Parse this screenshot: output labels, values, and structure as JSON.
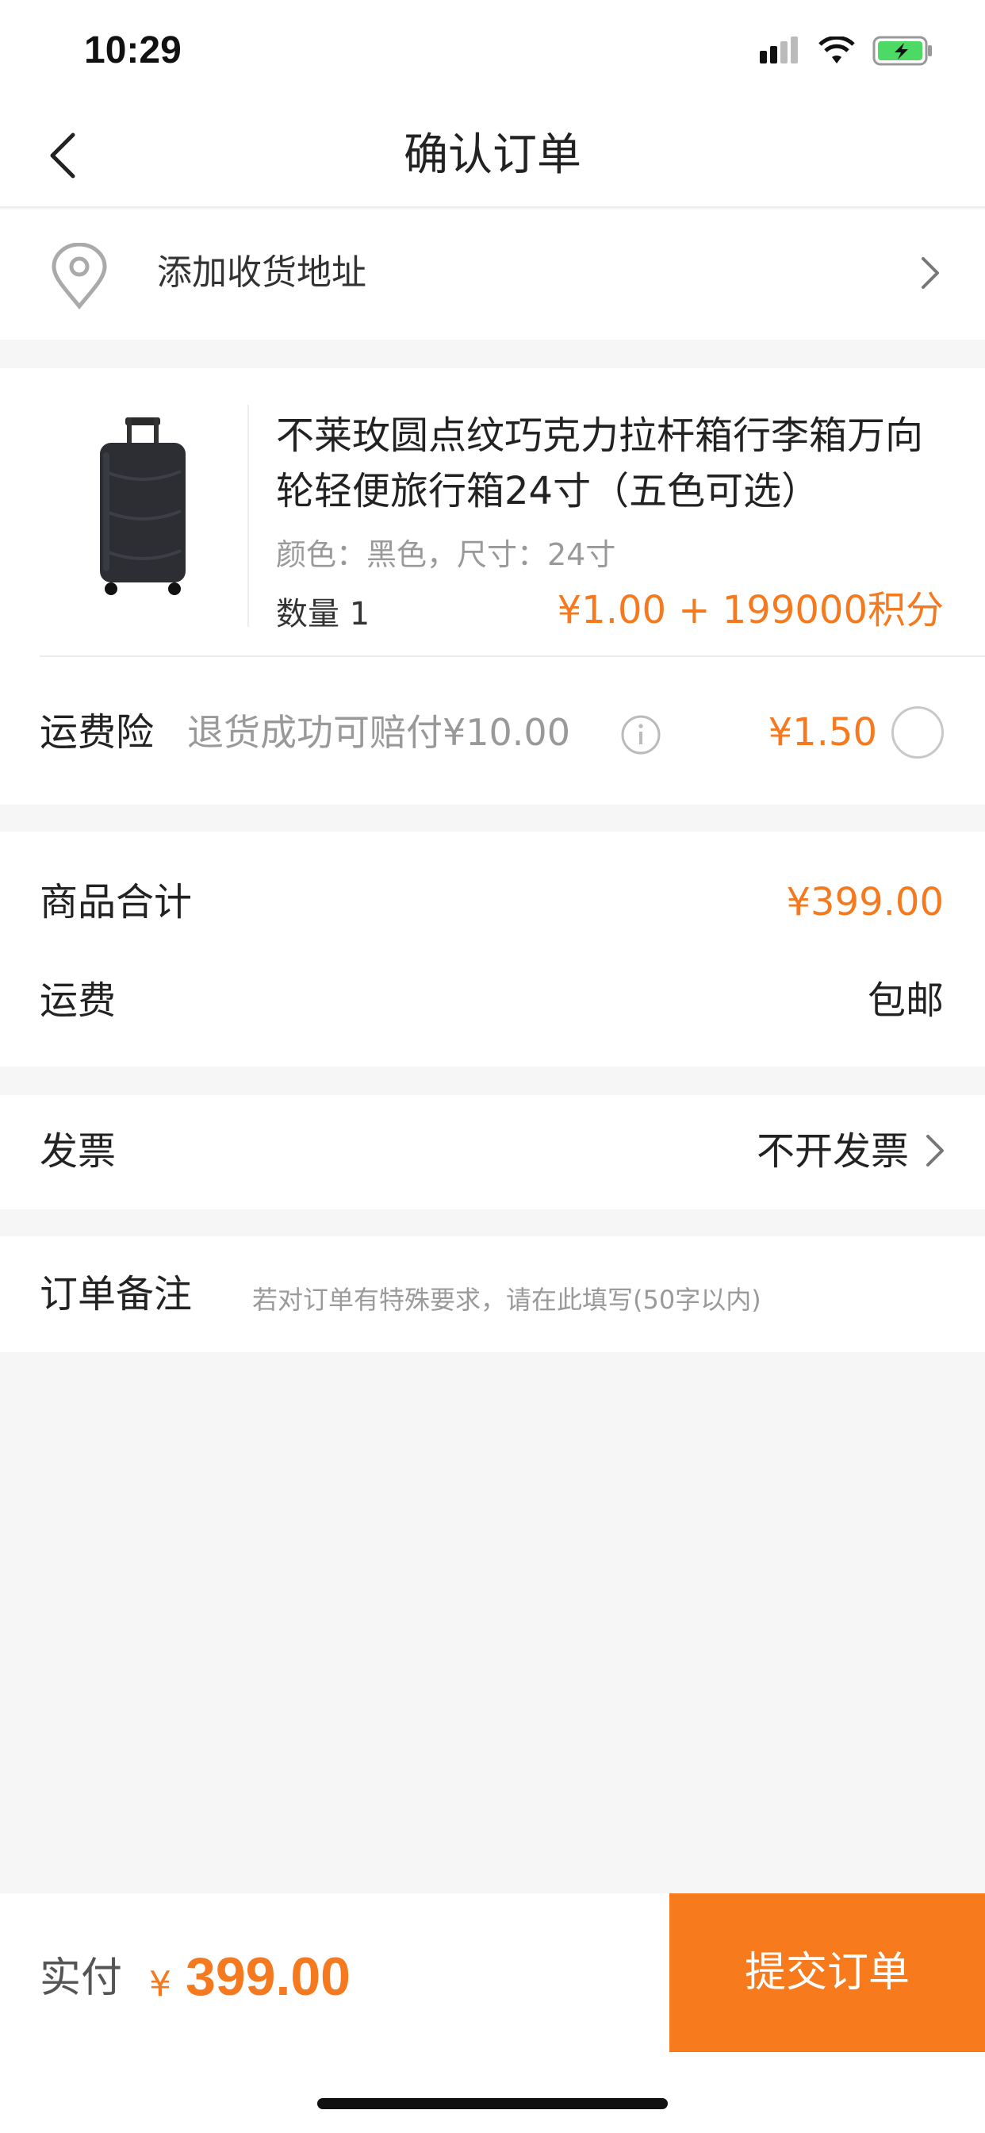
{
  "status_bar": {
    "time": "10:29"
  },
  "header": {
    "title": "确认订单"
  },
  "address": {
    "label": "添加收货地址"
  },
  "product": {
    "title": "不莱玫圆点纹巧克力拉杆箱行李箱万向轮轻便旅行箱24寸（五色可选）",
    "spec": "颜色：黑色，尺寸：24寸",
    "quantity": "数量 1",
    "price": "¥1.00 + 199000积分"
  },
  "insurance": {
    "label": "运费险",
    "desc": "退货成功可赔付¥10.00",
    "price": "¥1.50"
  },
  "summary": {
    "goods_total_label": "商品合计",
    "goods_total_value": "¥399.00",
    "shipping_label": "运费",
    "shipping_value": "包邮"
  },
  "invoice": {
    "label": "发票",
    "value": "不开发票"
  },
  "note": {
    "label": "订单备注",
    "placeholder": "若对订单有特殊要求，请在此填写(50字以内)"
  },
  "footer": {
    "pay_label": "实付",
    "currency": "¥",
    "amount": "399.00",
    "submit_label": "提交订单"
  },
  "colors": {
    "accent": "#f57a1f",
    "button": "#f77a1c",
    "muted": "#999999",
    "background": "#f6f6f6"
  },
  "icons": [
    "signal-icon",
    "wifi-icon",
    "battery-charging-icon",
    "back-chevron-icon",
    "location-pin-icon",
    "chevron-right-icon",
    "info-icon",
    "radio-unchecked-icon",
    "suitcase-image"
  ]
}
